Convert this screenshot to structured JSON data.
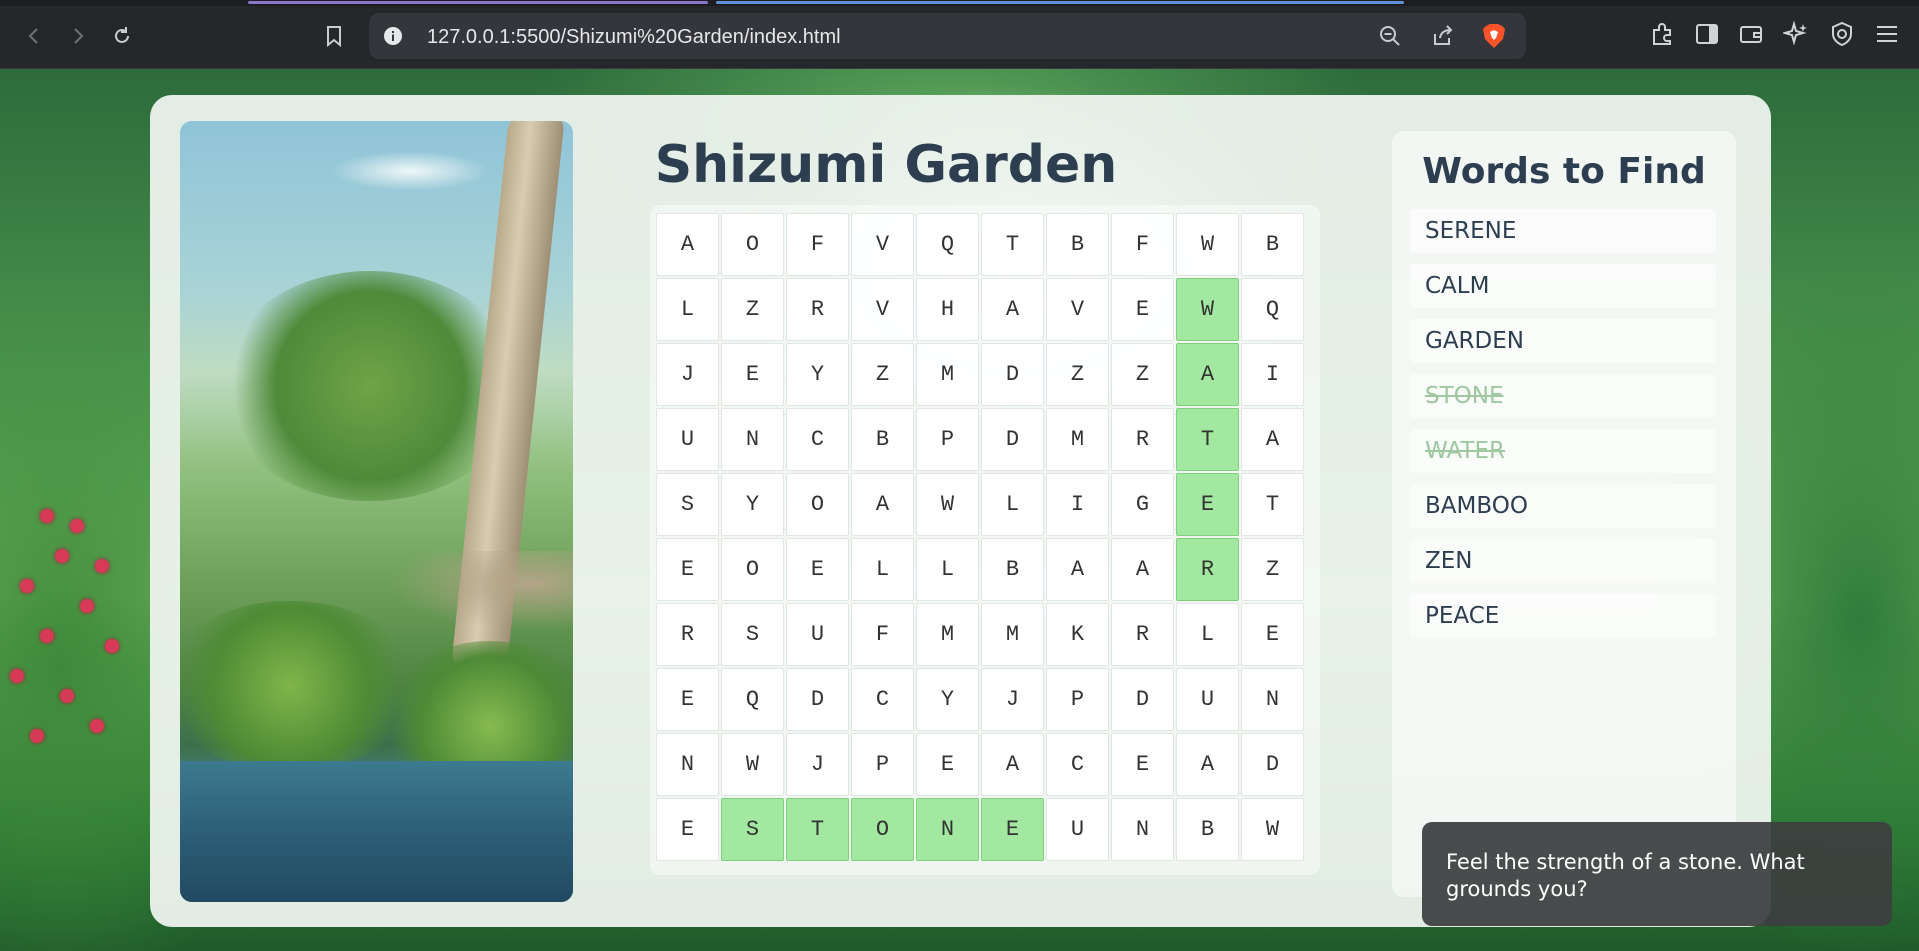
{
  "browser": {
    "url": "127.0.0.1:5500/Shizumi%20Garden/index.html",
    "icons": [
      "back-icon",
      "forward-icon",
      "reload-icon",
      "bookmark-icon",
      "info-icon",
      "zoom-out-icon",
      "share-icon",
      "brave-shield-icon",
      "extensions-icon",
      "sidebar-icon",
      "wallet-icon",
      "leo-icon",
      "vpn-icon",
      "menu-icon"
    ]
  },
  "game": {
    "title": "Shizumi Garden",
    "grid": [
      [
        "A",
        "O",
        "F",
        "V",
        "Q",
        "T",
        "B",
        "F",
        "W",
        "B"
      ],
      [
        "L",
        "Z",
        "R",
        "V",
        "H",
        "A",
        "V",
        "E",
        "W",
        "Q"
      ],
      [
        "J",
        "E",
        "Y",
        "Z",
        "M",
        "D",
        "Z",
        "Z",
        "A",
        "I"
      ],
      [
        "U",
        "N",
        "C",
        "B",
        "P",
        "D",
        "M",
        "R",
        "T",
        "A"
      ],
      [
        "S",
        "Y",
        "O",
        "A",
        "W",
        "L",
        "I",
        "G",
        "E",
        "T"
      ],
      [
        "E",
        "O",
        "E",
        "L",
        "L",
        "B",
        "A",
        "A",
        "R",
        "Z"
      ],
      [
        "R",
        "S",
        "U",
        "F",
        "M",
        "M",
        "K",
        "R",
        "L",
        "E"
      ],
      [
        "E",
        "Q",
        "D",
        "C",
        "Y",
        "J",
        "P",
        "D",
        "U",
        "N"
      ],
      [
        "N",
        "W",
        "J",
        "P",
        "E",
        "A",
        "C",
        "E",
        "A",
        "D"
      ],
      [
        "E",
        "S",
        "T",
        "O",
        "N",
        "E",
        "U",
        "N",
        "B",
        "W"
      ]
    ],
    "found_cells": [
      [
        1,
        8
      ],
      [
        2,
        8
      ],
      [
        3,
        8
      ],
      [
        4,
        8
      ],
      [
        5,
        8
      ],
      [
        9,
        1
      ],
      [
        9,
        2
      ],
      [
        9,
        3
      ],
      [
        9,
        4
      ],
      [
        9,
        5
      ]
    ],
    "highlight_color": "#a2e8a0"
  },
  "word_list": {
    "heading": "Words to Find",
    "items": [
      {
        "label": "SERENE",
        "found": false
      },
      {
        "label": "CALM",
        "found": false
      },
      {
        "label": "GARDEN",
        "found": false
      },
      {
        "label": "STONE",
        "found": true
      },
      {
        "label": "WATER",
        "found": true
      },
      {
        "label": "BAMBOO",
        "found": false
      },
      {
        "label": "ZEN",
        "found": false
      },
      {
        "label": "PEACE",
        "found": false
      }
    ]
  },
  "toast": {
    "message": "Feel the strength of a stone. What grounds you?"
  }
}
